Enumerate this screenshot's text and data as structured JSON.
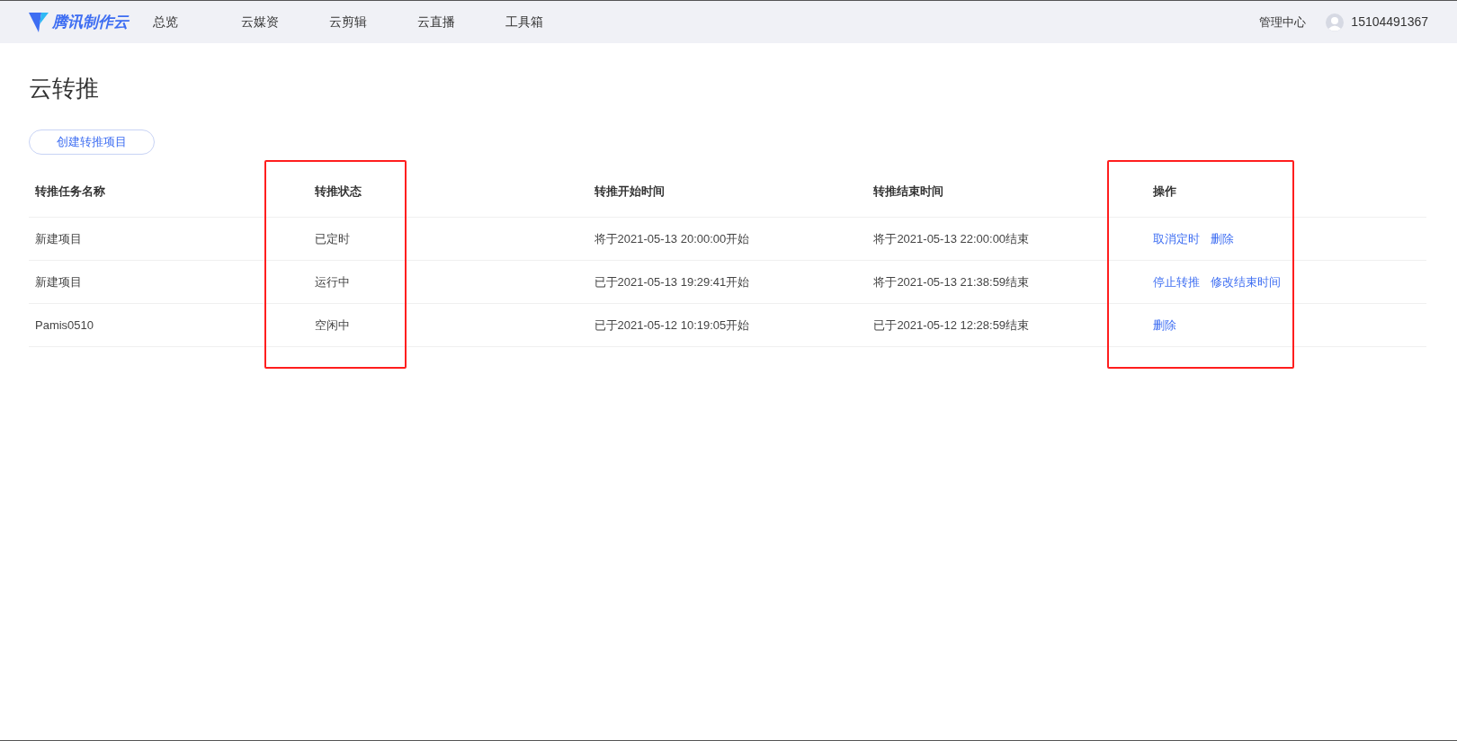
{
  "navbar": {
    "brand": "腾讯制作云",
    "items": [
      {
        "label": "总览",
        "selected": false
      },
      {
        "label": "云媒资",
        "selected": false
      },
      {
        "label": "云剪辑",
        "selected": false
      },
      {
        "label": "云直播",
        "selected": false
      },
      {
        "label": "工具箱",
        "selected": false
      }
    ],
    "admin_link": "管理中心",
    "user": "15104491367"
  },
  "page_title": "云转推",
  "create_button": "创建转推项目",
  "table": {
    "columns": [
      {
        "label": "转推任务名称",
        "highlighted": false
      },
      {
        "label": "转推状态",
        "highlighted": true
      },
      {
        "label": "转推开始时间",
        "highlighted": false
      },
      {
        "label": "转推结束时间",
        "highlighted": false
      },
      {
        "label": "操作",
        "highlighted": true
      }
    ],
    "rows": [
      {
        "name": "新建项目",
        "status": "已定时",
        "start": "将于2021-05-13 20:00:00开始",
        "end": "将于2021-05-13 22:00:00结束",
        "actions": [
          "取消定时",
          "删除"
        ]
      },
      {
        "name": "新建项目",
        "status": "运行中",
        "start": "已于2021-05-13 19:29:41开始",
        "end": "将于2021-05-13 21:38:59结束",
        "actions": [
          "停止转推",
          "修改结束时间"
        ]
      },
      {
        "name": "Pamis0510",
        "status": "空闲中",
        "start": "已于2021-05-12 10:19:05开始",
        "end": "已于2021-05-12 12:28:59结束",
        "actions": [
          "删除"
        ]
      }
    ]
  }
}
